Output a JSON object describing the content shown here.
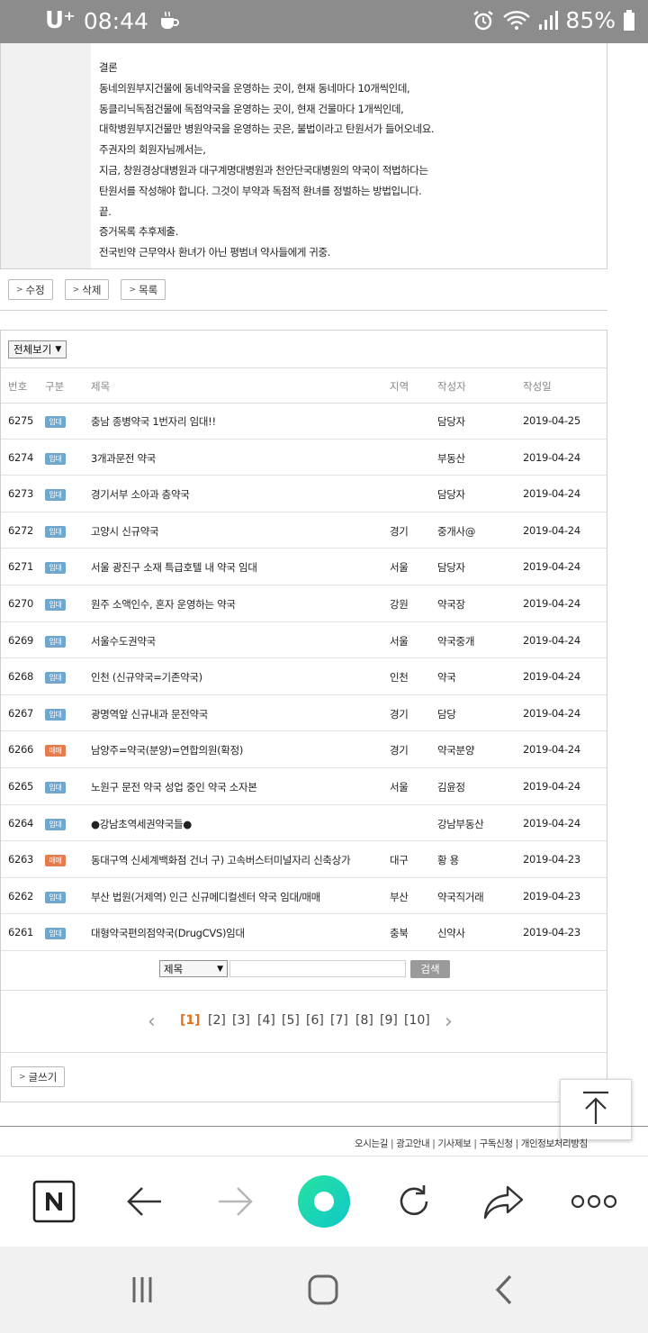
{
  "status_bar": {
    "carrier": "U⁺",
    "time": "08:44",
    "battery": "85%",
    "icons": [
      "coffee-icon",
      "alarm-icon",
      "wifi-icon",
      "signal-icon",
      "battery-icon"
    ]
  },
  "article": {
    "lines": [
      "결론",
      "동네의원부지건물에 동네약국을 운영하는 곳이, 현재 동네마다 10개씩인데,",
      "동클리닉독점건물에 독점약국을 운영하는 곳이, 현재 건물마다 1개씩인데,",
      "대학병원부지건물만 병원약국을 운영하는 곳은, 불법이라고 탄원서가 들어오네요.",
      "주권자의 회원자님께서는,",
      "지금, 창원경상대병원과 대구계명대병원과 천안단국대병원의 약국이 적법하다는",
      "탄원서를 작성해야 합니다. 그것이 부약과 독점적 환녀를 정벌하는 방법입니다.",
      "끝.",
      "증거목록 추후제출.",
      "전국빈약 근무약사 환녀가 아닌 평범녀 약사들에게 귀중."
    ],
    "buttons": {
      "edit": "수정",
      "delete": "삭제",
      "list": "목록"
    }
  },
  "board": {
    "filter_label": "전체보기",
    "columns": {
      "no": "번호",
      "category": "구분",
      "title": "제목",
      "region": "지역",
      "author": "작성자",
      "date": "작성일"
    },
    "rows": [
      {
        "no": "6275",
        "category": "임대",
        "title": "충남 종병약국 1번자리 임대!!",
        "region": "",
        "author": "담당자",
        "date": "2019-04-25"
      },
      {
        "no": "6274",
        "category": "임대",
        "title": "3개과문전 약국",
        "region": "",
        "author": "부동산",
        "date": "2019-04-24"
      },
      {
        "no": "6273",
        "category": "임대",
        "title": "경기서부 소아과 층약국",
        "region": "",
        "author": "담당자",
        "date": "2019-04-24"
      },
      {
        "no": "6272",
        "category": "임대",
        "title": "고양시 신규약국",
        "region": "경기",
        "author": "중개사@",
        "date": "2019-04-24"
      },
      {
        "no": "6271",
        "category": "임대",
        "title": "서울 광진구 소재 특급호텔 내 약국 임대",
        "region": "서울",
        "author": "담당자",
        "date": "2019-04-24"
      },
      {
        "no": "6270",
        "category": "임대",
        "title": "원주 소액인수, 혼자 운영하는 약국",
        "region": "강원",
        "author": "약국장",
        "date": "2019-04-24"
      },
      {
        "no": "6269",
        "category": "임대",
        "title": "서울수도권약국",
        "region": "서울",
        "author": "약국중개",
        "date": "2019-04-24"
      },
      {
        "no": "6268",
        "category": "임대",
        "title": "인천 (신규약국=기존약국)",
        "region": "인천",
        "author": "약국",
        "date": "2019-04-24"
      },
      {
        "no": "6267",
        "category": "임대",
        "title": "광명역앞 신규내과 문전약국",
        "region": "경기",
        "author": "담당",
        "date": "2019-04-24"
      },
      {
        "no": "6266",
        "category": "매매",
        "title": "남양주=약국(분양)=연합의원(확정)",
        "region": "경기",
        "author": "약국분양",
        "date": "2019-04-24"
      },
      {
        "no": "6265",
        "category": "임대",
        "title": "노원구 문전 약국 성업 중인 약국 소자본",
        "region": "서울",
        "author": "김윤정",
        "date": "2019-04-24"
      },
      {
        "no": "6264",
        "category": "임대",
        "title": "●강남초역세권약국들●",
        "region": "",
        "author": "강남부동산",
        "date": "2019-04-24"
      },
      {
        "no": "6263",
        "category": "매매",
        "title": "동대구역 신세계백화점 건너 구) 고속버스터미널자리 신축상가",
        "region": "대구",
        "author": "황 용",
        "date": "2019-04-23"
      },
      {
        "no": "6262",
        "category": "임대",
        "title": "부산 법원(거제역) 인근 신규메디컬센터 약국 임대/매매",
        "region": "부산",
        "author": "약국직거래",
        "date": "2019-04-23"
      },
      {
        "no": "6261",
        "category": "임대",
        "title": "대형약국편의점약국(DrugCVS)임대",
        "region": "충북",
        "author": "신약사",
        "date": "2019-04-23"
      }
    ],
    "search": {
      "select_value": "제목",
      "input_value": "",
      "button_label": "검색"
    },
    "pagination": {
      "pages": [
        "[1]",
        "[2]",
        "[3]",
        "[4]",
        "[5]",
        "[6]",
        "[7]",
        "[8]",
        "[9]",
        "[10]"
      ],
      "current": "[1]"
    },
    "write_button": "글쓰기"
  },
  "footer": {
    "links": [
      "오시는길",
      "광고안내",
      "기사제보",
      "구독신청",
      "개인정보처리방침"
    ]
  },
  "browser_bar": {
    "items": [
      "naver-icon",
      "back-arrow-icon",
      "forward-arrow-icon",
      "home-circle-icon",
      "refresh-icon",
      "share-icon",
      "more-icon"
    ]
  },
  "nav_bar": {
    "items": [
      "recent-apps-icon",
      "home-icon",
      "back-icon"
    ]
  },
  "colors": {
    "status_bar": "#8c8c8c",
    "rent_badge": "#6fa7cf",
    "sale_badge": "#e47c4f",
    "active_page": "#e0701e",
    "home_button": "#1fd6a8"
  }
}
